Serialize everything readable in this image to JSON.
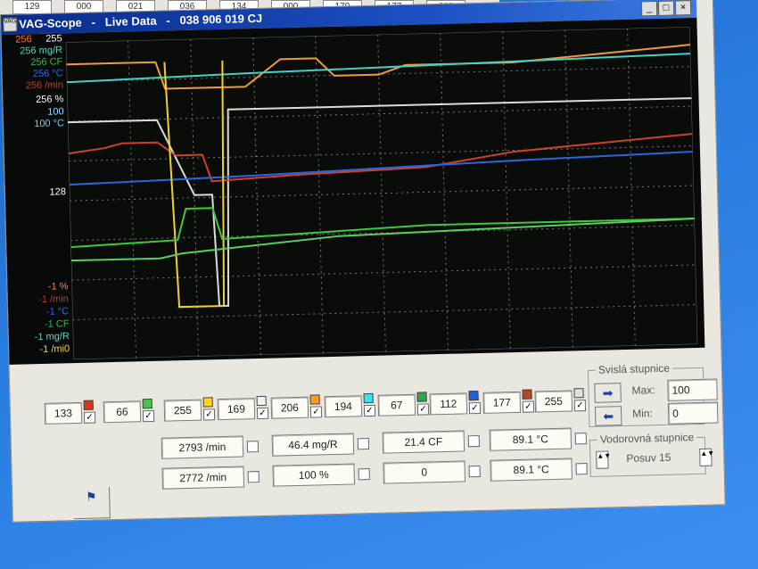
{
  "background_window": {
    "values": [
      "129",
      "000",
      "021",
      "036",
      "134",
      "000",
      "170",
      "177",
      "000"
    ]
  },
  "window": {
    "icon_text": "VAG",
    "title": "VAG-Scope   -   Live Data   -   038 906 019 CJ",
    "minimize": "_",
    "maximize": "□",
    "close": "×"
  },
  "axis_labels_top": [
    {
      "text": "256",
      "color": "#ff7a2a"
    },
    {
      "text": "255",
      "color": "#ffffff"
    },
    {
      "text": "256 mg/R",
      "color": "#40e0d0"
    },
    {
      "text": "256 CF",
      "color": "#2fbf4a"
    },
    {
      "text": "256 °C",
      "color": "#2a6cff"
    },
    {
      "text": "256 /min",
      "color": "#c0402a"
    },
    {
      "text": "256 %",
      "color": "#ffffff"
    },
    {
      "text": "100",
      "color": "#9ad6ff"
    },
    {
      "text": "100 °C",
      "color": "#6fd0ff"
    }
  ],
  "axis_labels_mid": "128",
  "axis_labels_bottom": [
    {
      "text": "-1 %",
      "color": "#ff8a3a"
    },
    {
      "text": "-1 /min",
      "color": "#c0402a"
    },
    {
      "text": "-1 °C",
      "color": "#2a6cff"
    },
    {
      "text": "-1 CF",
      "color": "#2fbf4a"
    },
    {
      "text": "-1 mg/R",
      "color": "#40e0d0"
    },
    {
      "text": "-1 /mi0",
      "color": "#ffd34a"
    }
  ],
  "channels": [
    {
      "value": "133",
      "color": "#d23a1e",
      "checked": true
    },
    {
      "value": "66",
      "color": "#4cc24c",
      "checked": true
    },
    {
      "value": "255",
      "color": "#ffd21c",
      "checked": true
    },
    {
      "value": "169",
      "color": "#f2f2f2",
      "checked": true
    },
    {
      "value": "206",
      "color": "#ff9a2a",
      "checked": true
    },
    {
      "value": "194",
      "color": "#40e0e8",
      "checked": true
    },
    {
      "value": "67",
      "color": "#2fa84a",
      "checked": true
    },
    {
      "value": "112",
      "color": "#1f5fe0",
      "checked": true
    },
    {
      "value": "177",
      "color": "#b04a2a",
      "checked": true
    },
    {
      "value": "255",
      "color": "#e0e0e0",
      "checked": true
    }
  ],
  "readouts_row1": [
    "2793 /min",
    "46.4 mg/R",
    "21.4 CF",
    "89.1 °C"
  ],
  "readouts_row2": [
    "2772 /min",
    "100 %",
    "0",
    "89.1 °C"
  ],
  "vertical_scale": {
    "legend": "Svislá stupnice",
    "max_label": "Max:",
    "max_value": "100",
    "min_label": "Min:",
    "min_value": "0"
  },
  "horizontal_scale": {
    "legend": "Vodorovná stupnice",
    "value": "Posuv 15"
  },
  "traces": [
    {
      "name": "orange",
      "color": "#f09a3a",
      "points": [
        [
          0,
          25
        ],
        [
          100,
          25
        ],
        [
          110,
          55
        ],
        [
          200,
          55
        ],
        [
          240,
          25
        ],
        [
          280,
          25
        ],
        [
          300,
          45
        ],
        [
          350,
          45
        ],
        [
          380,
          35
        ],
        [
          500,
          35
        ],
        [
          700,
          20
        ]
      ]
    },
    {
      "name": "cyan",
      "color": "#46d0c8",
      "points": [
        [
          0,
          45
        ],
        [
          200,
          40
        ],
        [
          700,
          30
        ]
      ]
    },
    {
      "name": "white",
      "color": "#dcdcdc",
      "points": [
        [
          0,
          90
        ],
        [
          100,
          90
        ],
        [
          140,
          175
        ],
        [
          160,
          175
        ],
        [
          165,
          300
        ],
        [
          175,
          300
        ],
        [
          180,
          80
        ],
        [
          250,
          80
        ],
        [
          400,
          80
        ],
        [
          700,
          80
        ]
      ]
    },
    {
      "name": "red",
      "color": "#d0402a",
      "points": [
        [
          0,
          125
        ],
        [
          40,
          120
        ],
        [
          60,
          115
        ],
        [
          100,
          115
        ],
        [
          120,
          130
        ],
        [
          150,
          130
        ],
        [
          160,
          160
        ],
        [
          260,
          155
        ],
        [
          400,
          150
        ],
        [
          500,
          135
        ],
        [
          700,
          120
        ]
      ]
    },
    {
      "name": "blue",
      "color": "#2a66e0",
      "points": [
        [
          0,
          160
        ],
        [
          200,
          155
        ],
        [
          500,
          145
        ],
        [
          700,
          140
        ]
      ]
    },
    {
      "name": "yellow",
      "color": "#f0d030",
      "points": [
        [
          110,
          25
        ],
        [
          120,
          300
        ],
        [
          160,
          300
        ],
        [
          170,
          300
        ],
        [
          175,
          25
        ]
      ]
    },
    {
      "name": "green",
      "color": "#3ccb3a",
      "points": [
        [
          0,
          230
        ],
        [
          120,
          225
        ],
        [
          130,
          190
        ],
        [
          160,
          190
        ],
        [
          170,
          225
        ],
        [
          400,
          215
        ],
        [
          700,
          215
        ]
      ]
    },
    {
      "name": "green-light",
      "color": "#5ad05a",
      "points": [
        [
          0,
          245
        ],
        [
          100,
          245
        ],
        [
          125,
          240
        ],
        [
          300,
          225
        ],
        [
          700,
          215
        ]
      ]
    }
  ]
}
